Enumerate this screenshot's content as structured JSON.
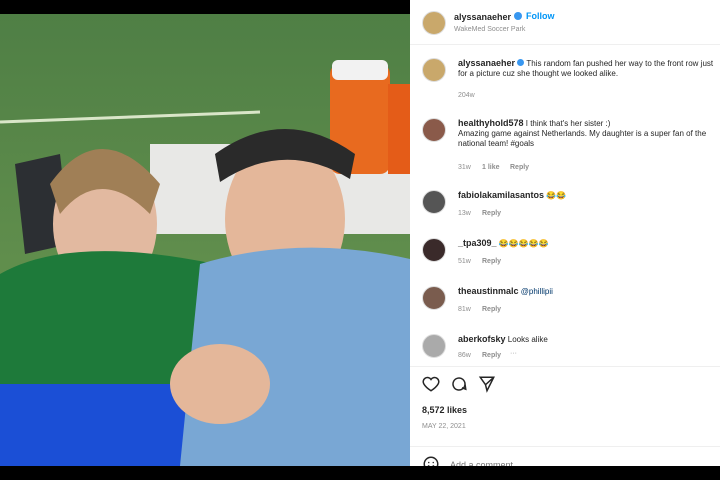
{
  "colors": {
    "link": "#0095f6",
    "verified": "#3897f0",
    "text": "#262626",
    "meta": "#8e8e8e"
  },
  "header": {
    "username": "alyssanaeher",
    "follow_label": "Follow",
    "subtitle": "WakeMed Soccer Park"
  },
  "caption": {
    "username": "alyssanaeher",
    "text": "This random fan pushed her way to the front row just for a picture cuz she thought we looked alike.",
    "time": "204w"
  },
  "comments": [
    {
      "username": "healthyhold578",
      "text": "I think that's her sister :)",
      "text2": "Amazing game against Netherlands. My daughter is a super fan of the national team! #goals",
      "time": "31w",
      "likes": "1 like",
      "reply": "Reply"
    },
    {
      "username": "fabiolakamilasantos",
      "text": "😂😂",
      "time": "13w",
      "reply": "Reply"
    },
    {
      "username": "_tpa309_",
      "text": "😂😂😂😂😂",
      "time": "51w",
      "reply": "Reply"
    },
    {
      "username": "theaustinmalc",
      "text": "@phillipii",
      "time": "81w",
      "reply": "Reply"
    },
    {
      "username": "aberkofsky",
      "text": "Looks alike",
      "time": "86w",
      "reply": "Reply",
      "more": "···"
    }
  ],
  "actions": {
    "likes": "8,572 likes",
    "date": "MAY 22, 2021"
  },
  "add_comment": {
    "placeholder": "Add a comment..."
  }
}
